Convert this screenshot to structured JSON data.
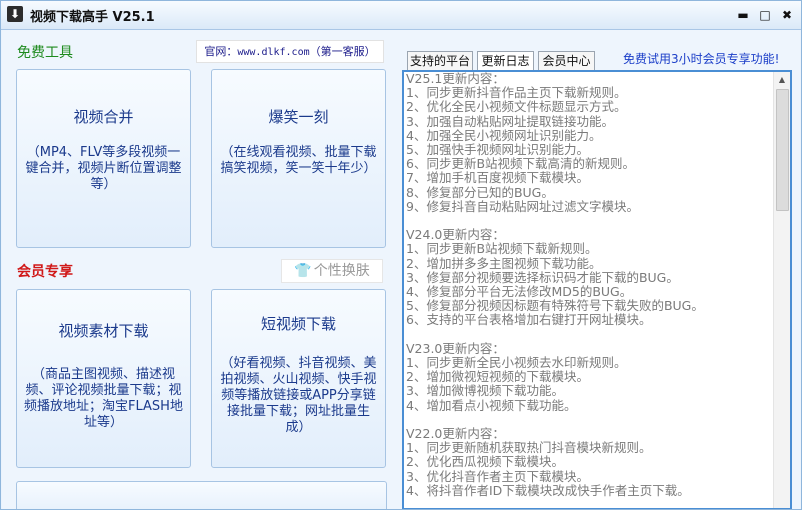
{
  "window": {
    "title": "视频下载高手 V25.1",
    "icon": "film-download-icon",
    "controls": {
      "minimize": "▬",
      "maximize": "□",
      "close": "✖"
    }
  },
  "left": {
    "free_tools_label": "免费工具",
    "website_prefix": "官网：",
    "website_url": "www.dlkf.com",
    "website_suffix": "（第一客服）",
    "members_label": "会员专享",
    "skin_button": "个性换肤",
    "cards": {
      "merge": {
        "title": "视频合并",
        "desc": "（MP4、FLV等多段视频一键合并，视频片断位置调整等）"
      },
      "funny": {
        "title": "爆笑一刻",
        "desc": "（在线观看视频、批量下载搞笑视频，笑一笑十年少）"
      },
      "material": {
        "title": "视频素材下载",
        "desc": "（商品主图视频、描述视频、评论视频批量下载；视频播放地址；淘宝FLASH地址等）"
      },
      "short": {
        "title": "短视频下载",
        "desc": "（好看视频、抖音视频、美拍视频、火山视频、快手视频等播放链接或APP分享链接批量下载；网址批量生成）"
      }
    }
  },
  "right": {
    "tabs": [
      "支持的平台",
      "更新日志",
      "会员中心"
    ],
    "active_tab": "更新日志",
    "trial_link": "免费试用3小时会员专享功能!",
    "changelog": [
      "V25.1更新内容：",
      "1、同步更新抖音作品主页下载新规则。",
      "2、优化全民小视频文件标题显示方式。",
      "3、加强自动粘贴网址提取链接功能。",
      "4、加强全民小视频网址识别能力。",
      "5、加强快手视频网址识别能力。",
      "6、同步更新B站视频下载高清的新规则。",
      "7、增加手机百度视频下载模块。",
      "8、修复部分已知的BUG。",
      "9、修复抖音自动粘贴网址过滤文字模块。",
      "",
      "V24.0更新内容：",
      "1、同步更新B站视频下载新规则。",
      "2、增加拼多多主图视频下载功能。",
      "3、修复部分视频要选择标识码才能下载的BUG。",
      "4、修复部分平台无法修改MD5的BUG。",
      "5、修复部分视频因标题有特殊符号下载失败的BUG。",
      "6、支持的平台表格增加右键打开网址模块。",
      "",
      "V23.0更新内容：",
      "1、同步更新全民小视频去水印新规则。",
      "2、增加微视短视频的下载模块。",
      "3、增加微博视频下载功能。",
      "4、增加看点小视频下载功能。",
      "",
      "V22.0更新内容：",
      "1、同步更新随机获取热门抖音模块新规则。",
      "2、优化西瓜视频下载模块。",
      "3、优化抖音作者主页下载模块。",
      "4、将抖音作者ID下载模块改成快手作者主页下载。"
    ]
  }
}
